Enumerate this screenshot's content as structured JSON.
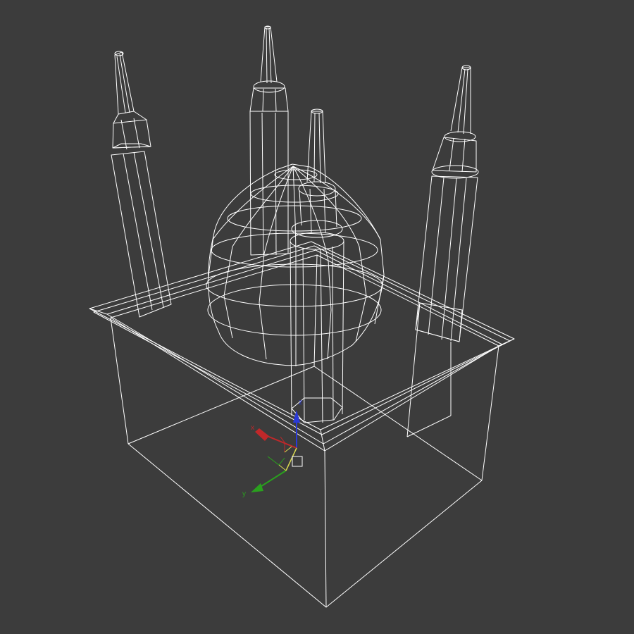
{
  "viewport": {
    "view_mode": "wireframe",
    "background_color": "#3c3c3c",
    "wire_color": "#ffffff"
  },
  "gizmo": {
    "axes": [
      {
        "label": "x",
        "color": "#c0282a"
      },
      {
        "label": "y",
        "color": "#2aa01e"
      },
      {
        "label": "z",
        "color": "#2a3ad8"
      }
    ],
    "plane_handle_color": "#d8d850",
    "pivot_icon": "pivot-square-icon"
  }
}
